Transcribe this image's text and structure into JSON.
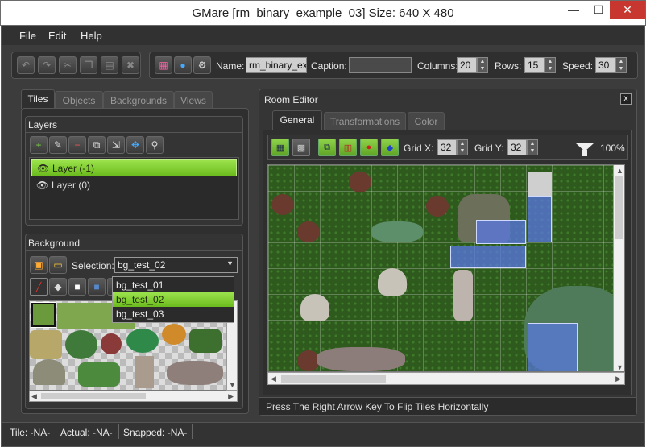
{
  "window": {
    "title": "GMare [rm_binary_example_03] Size: 640 X 480",
    "minimize": "—",
    "maximize": "☐",
    "close": "✕"
  },
  "menu": [
    "File",
    "Edit",
    "Help"
  ],
  "toolbar": {
    "name_label": "Name:",
    "name_value": "rm_binary_exam",
    "caption_label": "Caption:",
    "caption_value": "",
    "columns_label": "Columns:",
    "columns_value": "20",
    "rows_label": "Rows:",
    "rows_value": "15",
    "speed_label": "Speed:",
    "speed_value": "30"
  },
  "left_tabs": [
    "Tiles",
    "Objects",
    "Backgrounds",
    "Views"
  ],
  "layers": {
    "title": "Layers",
    "items": [
      {
        "name": "Layer (-1)",
        "selected": true
      },
      {
        "name": "Layer (0)",
        "selected": false
      }
    ]
  },
  "background": {
    "title": "Background",
    "selection_label": "Selection:",
    "selection_value": "bg_test_02",
    "options": [
      "bg_test_01",
      "bg_test_02",
      "bg_test_03"
    ],
    "selected_option": "bg_test_02"
  },
  "room_editor": {
    "title": "Room Editor",
    "close": "x",
    "tabs": [
      "General",
      "Transformations",
      "Color"
    ],
    "grid_x_label": "Grid X:",
    "grid_x_value": "32",
    "grid_y_label": "Grid Y:",
    "grid_y_value": "32",
    "zoom": "100%",
    "hint": "Press The Right Arrow Key To Flip Tiles Horizontally"
  },
  "status": {
    "tile": "Tile: -NA-",
    "actual": "Actual: -NA-",
    "snapped": "Snapped: -NA-"
  },
  "colors": {
    "accent_green": "#7fcf2a",
    "panel_dark": "#2f2f2f",
    "app_bg": "#3c3c3c"
  }
}
